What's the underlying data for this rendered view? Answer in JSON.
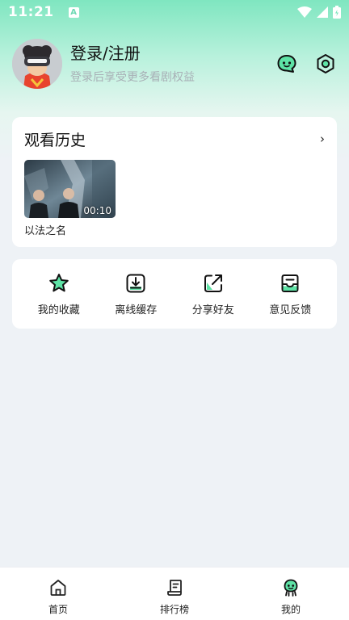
{
  "status_bar": {
    "time": "11:21",
    "notification_badge": "A"
  },
  "profile": {
    "title": "登录/注册",
    "subtitle": "登录后享受更多看剧权益"
  },
  "history": {
    "title": "观看历史",
    "more_glyph": "›",
    "items": [
      {
        "title": "以法之名",
        "time": "00:10"
      }
    ]
  },
  "actions": [
    {
      "label": "我的收藏",
      "icon": "star-icon"
    },
    {
      "label": "离线缓存",
      "icon": "download-icon"
    },
    {
      "label": "分享好友",
      "icon": "share-icon"
    },
    {
      "label": "意见反馈",
      "icon": "feedback-icon"
    }
  ],
  "nav": [
    {
      "label": "首页",
      "icon": "home-icon"
    },
    {
      "label": "排行榜",
      "icon": "ranking-icon"
    },
    {
      "label": "我的",
      "icon": "profile-icon",
      "active": true
    }
  ],
  "colors": {
    "accent": "#4fd49a",
    "accent_dark": "#111111",
    "background": "#eef2f6"
  }
}
